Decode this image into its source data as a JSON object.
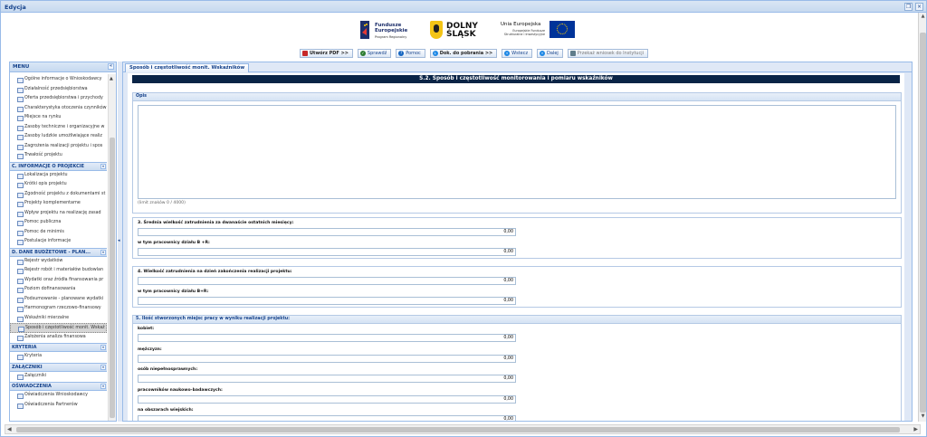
{
  "window": {
    "title": "Edycja"
  },
  "header": {
    "logos": {
      "fe_line1": "Fundusze",
      "fe_line2": "Europejskie",
      "fe_sub": "Program Regionalny",
      "ds_line1": "DOLNY",
      "ds_line2": "ŚLĄSK",
      "ue_title": "Unia Europejska",
      "ue_sub1": "Europejskie Fundusze",
      "ue_sub2": "Strukturalne i Inwestycyjne"
    },
    "toolbar": {
      "create_pdf": "Utwórz PDF >>",
      "check": "Sprawdź",
      "help": "Pomoc",
      "download": "Dok. do pobrania >>",
      "back": "Wstecz",
      "next": "Dalej",
      "submit": "Przekaż wniosek do Instytucji"
    }
  },
  "sidebar": {
    "title": "MENU",
    "groups": [
      {
        "title": "",
        "items": [
          "Ogólne informacje o Wnioskodawcy",
          "Działalność przedsiębiorstwa",
          "Oferta przedsiębiorstwa i przychody",
          "Charakterystyka otoczenia czynników",
          "Miejsce na rynku",
          "Zasoby techniczne i organizacyjne w",
          "Zasoby ludzkie umożliwiające realiz",
          "Zagrożenia realizacji projektu i spos",
          "Trwałość projektu"
        ]
      },
      {
        "title": "C. INFORMACJE O PROJEKCIE",
        "items": [
          "Lokalizacja projektu",
          "Krótki opis projektu",
          "Zgodność projektu z dokumentami st",
          "Projekty komplementarne",
          "Wpływ projektu na realizację zasad",
          "Pomoc publiczna",
          "Pomoc de minimis",
          "Postulacje informacje"
        ]
      },
      {
        "title": "D. DANE BUDŻETOWE - PLAN...",
        "items": [
          "Rejestr wydatków",
          "Rejestr robót i materiałów budowlan",
          "Wydatki oraz źródła finansowania pr",
          "Poziom dofinansowania",
          "Podsumowanie - planowane wydatki",
          "Harmonogram rzeczowo-finansowy",
          "Wskaźniki mierzalne",
          "Sposób i częstotliwość monit. Wskaź",
          "Założenia analiza finansowa"
        ]
      },
      {
        "title": "KRYTERIA",
        "items": [
          "Kryteria"
        ]
      },
      {
        "title": "ZAŁĄCZNIKI",
        "items": [
          "Załączniki"
        ]
      },
      {
        "title": "OŚWIADCZENIA",
        "items": [
          "Oświadczenia Wnioskodawcy",
          "Oświadczenia Partnerów"
        ]
      }
    ]
  },
  "main": {
    "tab_label": "Sposób i częstotliwość monit. Wskaźników",
    "section_title": "S.2. Sposób i częstotliwość monitorowania i pomiaru wskaźników",
    "opis": {
      "legend": "Opis",
      "value": "",
      "limit": "(limit znaków 0 / 4000)"
    },
    "fs3": {
      "legend": "3. Średnia wielkość zatrudnienia za dwanaście ostatnich miesięcy:",
      "value": "0,00",
      "sub_label": "w tym pracownicy działu B +R:",
      "sub_value": "0,00"
    },
    "fs4": {
      "legend": "4. Wielkość zatrudnienia na dzień zakończenia realizacji projektu:",
      "value": "0,00",
      "sub_label": "w tym pracownicy działu B+R:",
      "sub_value": "0,00"
    },
    "fs5": {
      "legend": "5. Ilość stworzonych miejsc pracy w wyniku realizacji projektu:",
      "fields": [
        {
          "label": "kobiet:",
          "value": "0,00"
        },
        {
          "label": "mężczyzn:",
          "value": "0,00"
        },
        {
          "label": "osób niepełnosprawnych:",
          "value": "0,00"
        },
        {
          "label": "pracowników naukowo-badawczych:",
          "value": "0,00"
        },
        {
          "label": "na obszarach wiejskich:",
          "value": "0,00"
        }
      ]
    }
  }
}
